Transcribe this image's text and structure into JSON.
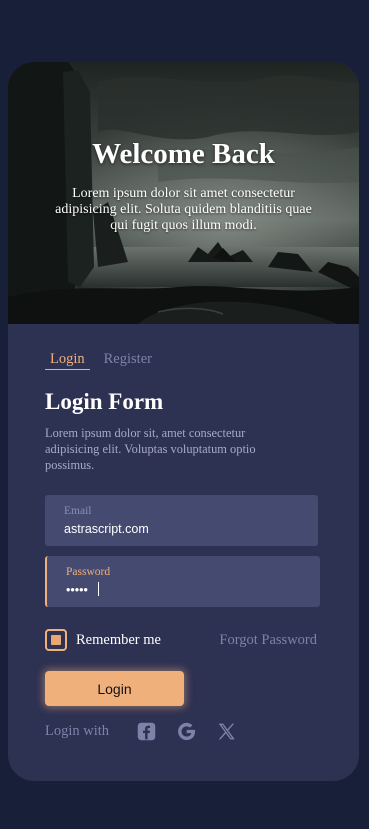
{
  "hero": {
    "title": "Welcome Back",
    "subtitle": "Lorem ipsum dolor sit amet consectetur adipisicing elit. Soluta quidem blanditiis quae qui fugit quos illum modi."
  },
  "tabs": [
    {
      "label": "Login",
      "active": true
    },
    {
      "label": "Register",
      "active": false
    }
  ],
  "form": {
    "title": "Login Form",
    "description": "Lorem ipsum dolor sit, amet consectetur adipisicing elit. Voluptas voluptatum optio possimus.",
    "email": {
      "label": "Email",
      "value": "astrascript.com"
    },
    "password": {
      "label": "Password",
      "value": "•••••"
    },
    "remember_label": "Remember me",
    "remember_checked": true,
    "forgot_label": "Forgot Password",
    "submit_label": "Login",
    "login_with_label": "Login with",
    "social_icons": [
      "facebook-icon",
      "google-icon",
      "x-icon"
    ]
  },
  "colors": {
    "page_bg": "#182039",
    "card_bg": "#2d3152",
    "accent": "#f0b07c",
    "field_bg": "#454a70",
    "muted": "#7d83a8"
  }
}
